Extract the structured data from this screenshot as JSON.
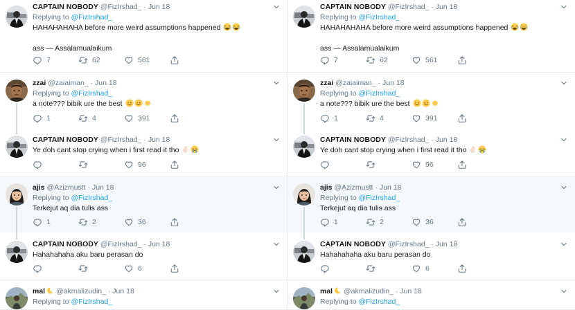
{
  "tweets": [
    {
      "name": "CAPTAIN NOBODY",
      "handle": "@FizIrshad_",
      "date": "· Jun 18",
      "replying_prefix": "Replying to ",
      "replying_to": "@FizIrshad_",
      "text": "HAHAHAHAHA before more weird assumptions happened",
      "text2": "ass — Assalamualaikum",
      "emojis": [
        "laugh",
        "laugh"
      ],
      "reply": "7",
      "retweet": "62",
      "like": "561"
    },
    {
      "name": "zzai",
      "handle": "@zaiaiman_",
      "date": "· Jun 18",
      "replying_prefix": "Replying to ",
      "replying_to": "@FizIrshad_",
      "text": "a note??? bibik ure the best",
      "emojis": [
        "smile",
        "smile",
        "hands"
      ],
      "reply": "1",
      "retweet": "4",
      "like": "391"
    },
    {
      "name": "CAPTAIN NOBODY",
      "handle": "@FizIrshad_",
      "date": "· Jun 18",
      "text": "Ye doh cant stop crying when i first read it tho",
      "emojis": [
        "palm",
        "cry"
      ],
      "reply": "",
      "retweet": "",
      "like": "96"
    },
    {
      "name": "ajis",
      "handle": "@Azizmustt",
      "date": "· Jun 18",
      "replying_prefix": "Replying to ",
      "replying_to": "@FizIrshad_",
      "text": "Terkejut aq dia tulis ass",
      "emojis": [],
      "reply": "1",
      "retweet": "2",
      "like": "36"
    },
    {
      "name": "CAPTAIN NOBODY",
      "handle": "@FizIrshad_",
      "date": "· Jun 18",
      "text": "Hahahahaha aku baru perasan do",
      "emojis": [],
      "reply": "",
      "retweet": "",
      "like": "6"
    },
    {
      "name": "mal",
      "name_emoji": "moon",
      "handle": "@akmalizudin_",
      "date": "· Jun 18",
      "replying_prefix": "Replying to ",
      "replying_to": "@FizIrshad_",
      "text": "",
      "emojis": [],
      "reply": "",
      "retweet": "",
      "like": ""
    }
  ],
  "colors": {
    "accent": "#1da1f2",
    "muted": "#657786",
    "separator": "#e6ecf0",
    "highlight": "#f5f8fa",
    "thread_line": "#ccd6dd"
  },
  "icons": {
    "reply": "reply-icon",
    "retweet": "retweet-icon",
    "like": "like-icon",
    "share": "share-icon",
    "menu": "chevron-down-icon"
  }
}
